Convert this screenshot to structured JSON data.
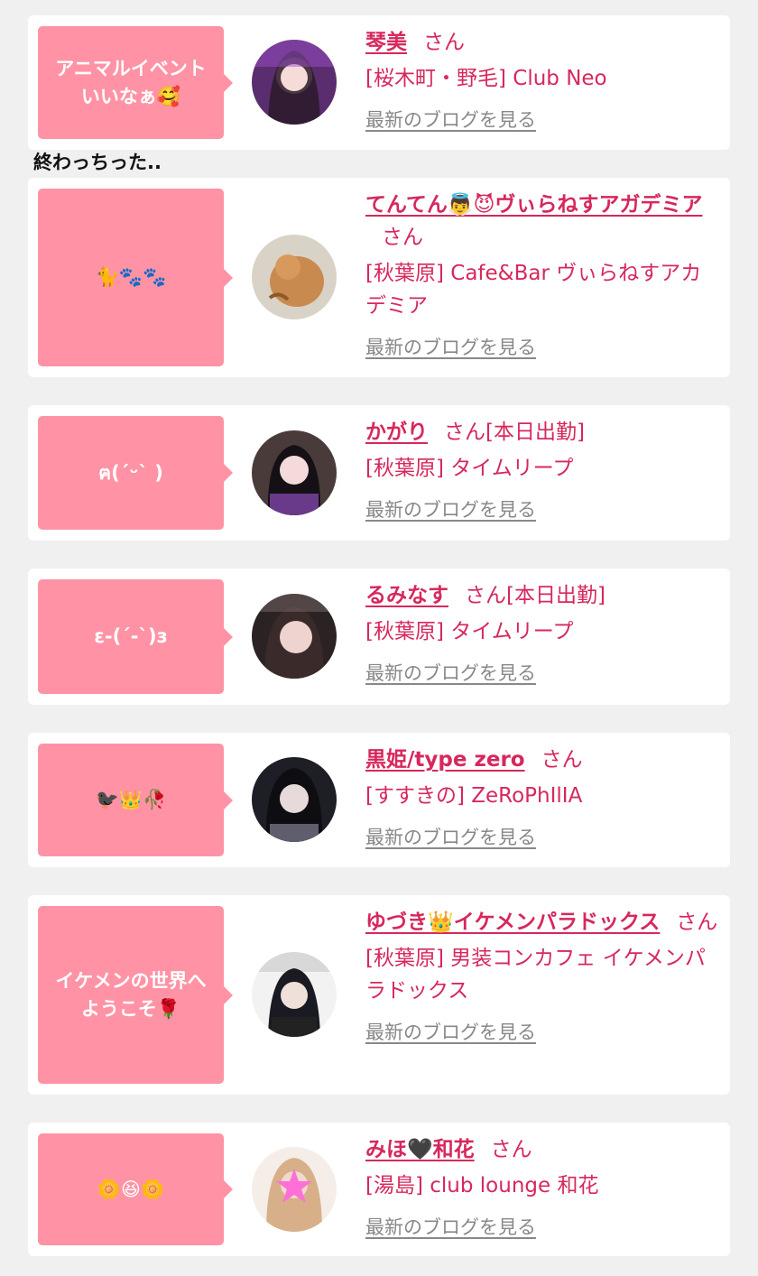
{
  "cards": [
    {
      "bubble": "アニマルイベント\nいいなぁ🥰",
      "name": "琴美",
      "san": "さん",
      "duty": "",
      "shop": "[桜木町・野毛] Club Neo",
      "blog": "最新のブログを見る"
    },
    {
      "bubble": "🐈🐾🐾",
      "name": "てんてん👼😈ヴぃらねすアガデミア",
      "san": "さん",
      "duty": "",
      "shop": "[秋葉原] Cafe&Bar ヴぃらねすアカデミア",
      "blog": "最新のブログを見る"
    },
    {
      "bubble": "ฅ(ˊᵕˋ )",
      "name": "かがり",
      "san": "さん",
      "duty": "[本日出勤]",
      "shop": "[秋葉原] タイムリープ",
      "blog": "最新のブログを見る"
    },
    {
      "bubble": "ε-(´‐`)з",
      "name": "るみなす",
      "san": "さん",
      "duty": "[本日出勤]",
      "shop": "[秋葉原] タイムリープ",
      "blog": "最新のブログを見る"
    },
    {
      "bubble": "🐦‍⬛👑🥀",
      "name": "黒姫/type zero",
      "san": "さん",
      "duty": "",
      "shop": "[すすきの] ZeRoPhIlIA",
      "blog": "最新のブログを見る"
    },
    {
      "bubble": "イケメンの世界へ\nようこそ🌹",
      "name": "ゆづき👑イケメンパラドックス",
      "san": "さん",
      "duty": "",
      "shop": "[秋葉原] 男装コンカフェ イケメンパラドックス",
      "blog": "最新のブログを見る"
    },
    {
      "bubble": "🌼😆🌼",
      "name": "みほ🖤和花",
      "san": "さん",
      "duty": "",
      "shop": "[湯島] club lounge 和花",
      "blog": "最新のブログを見る"
    }
  ],
  "overflow_text": "終わっちった..",
  "colors": {
    "accent": "#d6285c",
    "bubble": "#ff93a5",
    "link_gray": "#888888",
    "background": "#f0f0f0"
  },
  "icons": [
    "avatar-photo"
  ]
}
